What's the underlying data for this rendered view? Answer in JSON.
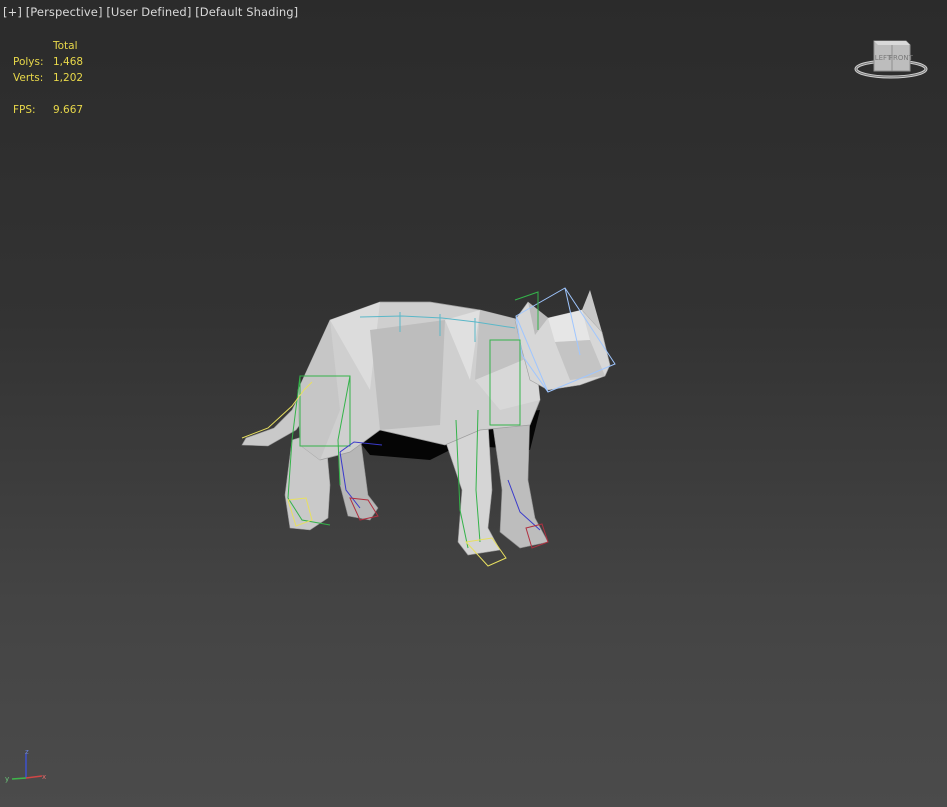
{
  "viewport": {
    "menu_plus": "[+]",
    "view": "[Perspective]",
    "camera": "[User Defined]",
    "shading": "[Default Shading]"
  },
  "stats": {
    "header": "Total",
    "polys_label": "Polys:",
    "polys_value": "1,468",
    "verts_label": "Verts:",
    "verts_value": "1,202",
    "fps_label": "FPS:",
    "fps_value": "9.667"
  },
  "viewcube": {
    "left_face": "LEFT",
    "front_face": "FRONT"
  },
  "axis": {
    "x": "x",
    "y": "y",
    "z": "z"
  },
  "colors": {
    "stats_text": "#e8d84a",
    "bone_green": "#34b34a",
    "bone_blue": "#3a3acb",
    "bone_cyan": "#5ab7c8",
    "bone_yellow": "#e8e060",
    "bone_red": "#b03040",
    "bone_head": "#9fc6ff"
  },
  "icons": [
    "viewcube-icon",
    "axis-tripod-icon"
  ]
}
